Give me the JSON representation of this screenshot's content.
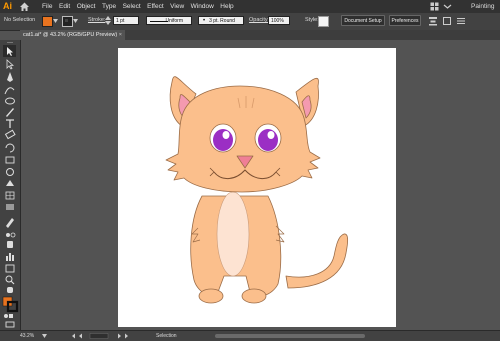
{
  "app": {
    "logo": "Ai",
    "workspace": "Painting"
  },
  "menu": [
    "File",
    "Edit",
    "Object",
    "Type",
    "Select",
    "Effect",
    "View",
    "Window",
    "Help"
  ],
  "control_bar": {
    "selection": "No Selection",
    "fill_color": "#e8731f",
    "stroke_label": "Stroke:",
    "stroke_weight": "1 pt",
    "profile": "Uniform",
    "brush": "3 pt. Round",
    "opacity_label": "Opacity:",
    "opacity": "100%",
    "style_label": "Style:",
    "document_setup": "Document Setup",
    "preferences": "Preferences"
  },
  "document_tab": {
    "title": "cat1.ai* @ 43.2% (RGB/GPU Preview)",
    "close": "×"
  },
  "status": {
    "zoom": "43.2%",
    "tool": "Selection"
  },
  "colors": {
    "cat_body": "#fbbf8c",
    "cat_belly": "#fde3d2",
    "ear_inner": "#f49ab0",
    "iris": "#9b2ec4",
    "nose": "#ef7f96"
  }
}
